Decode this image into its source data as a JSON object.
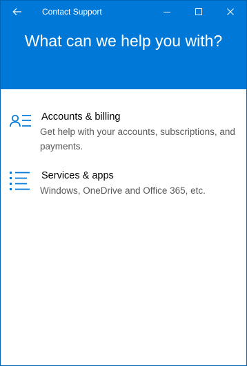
{
  "window": {
    "title": "Contact Support",
    "headline": "What can we help you with?"
  },
  "icons": {
    "back": "back-arrow-icon",
    "minimize": "minimize-icon",
    "maximize": "maximize-icon",
    "close": "close-icon",
    "accounts": "person-list-icon",
    "services": "bulleted-list-icon"
  },
  "options": [
    {
      "title": "Accounts & billing",
      "description": "Get help with your accounts, subscriptions, and payments."
    },
    {
      "title": "Services & apps",
      "description": "Windows, OneDrive and Office 365, etc."
    }
  ],
  "colors": {
    "accent": "#0078d7",
    "description_text": "#595959"
  }
}
